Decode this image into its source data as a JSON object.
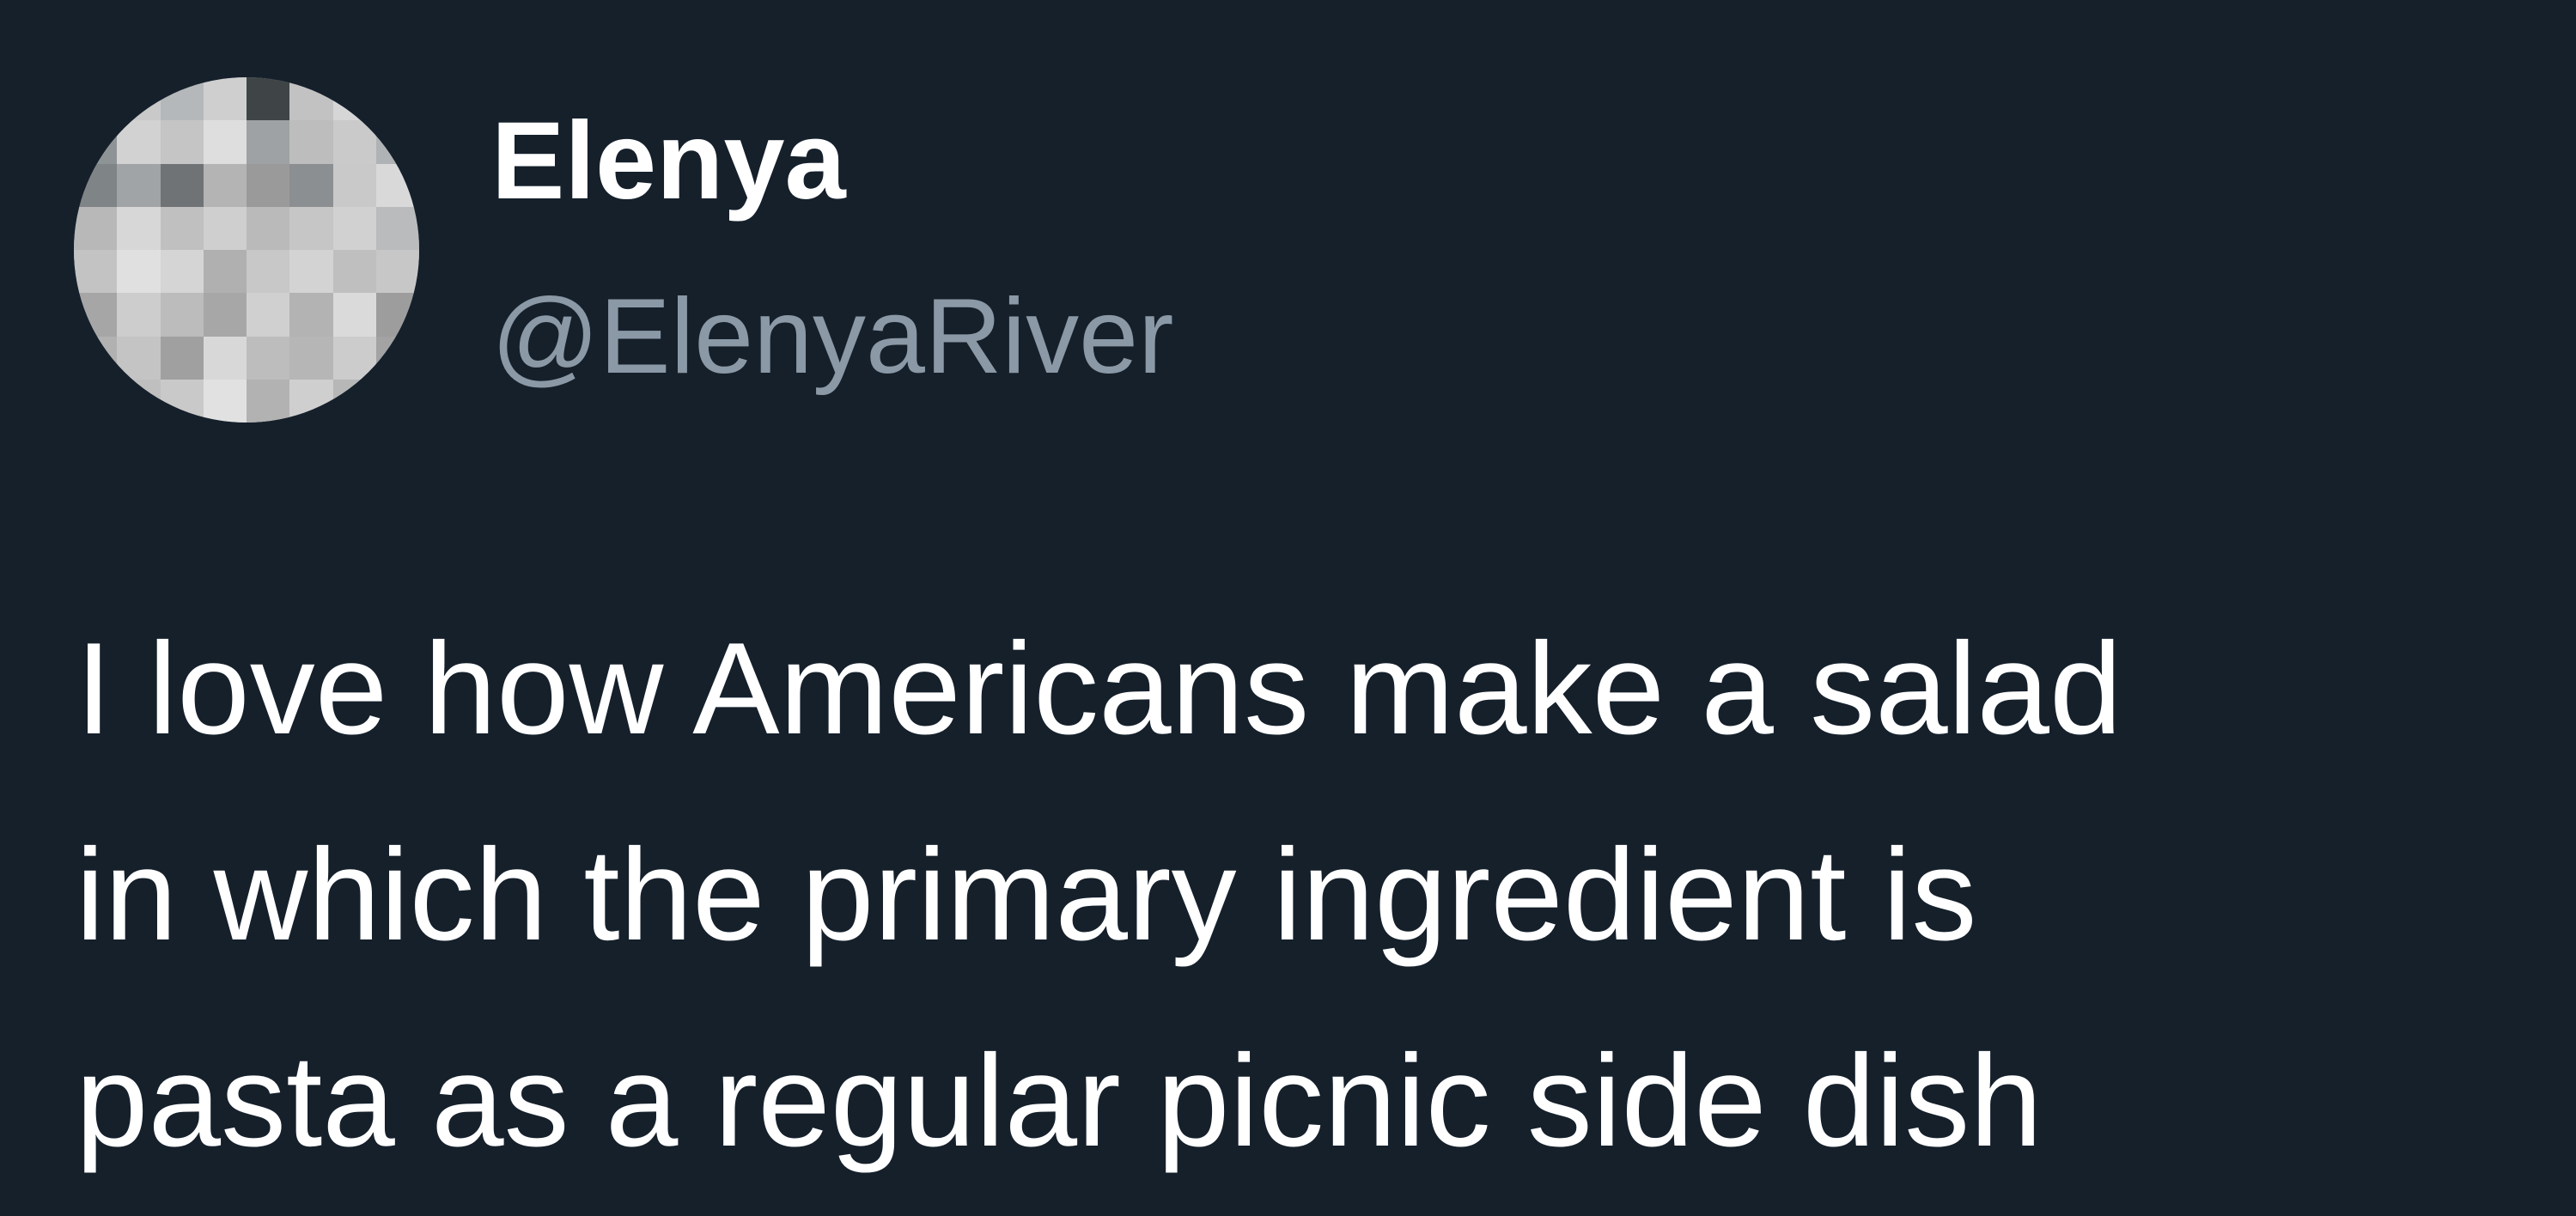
{
  "tweet": {
    "author": {
      "display_name": "Elenya",
      "handle": "@ElenyaRiver",
      "avatar_icon": "pixelated-avatar"
    },
    "text_lines": [
      "I love how Americans make a salad",
      "in which the primary ingredient is",
      "pasta as a regular picnic side dish"
    ]
  },
  "colors": {
    "background": "#15202b",
    "primary_text": "#ffffff",
    "secondary_text": "#8b98a5"
  }
}
